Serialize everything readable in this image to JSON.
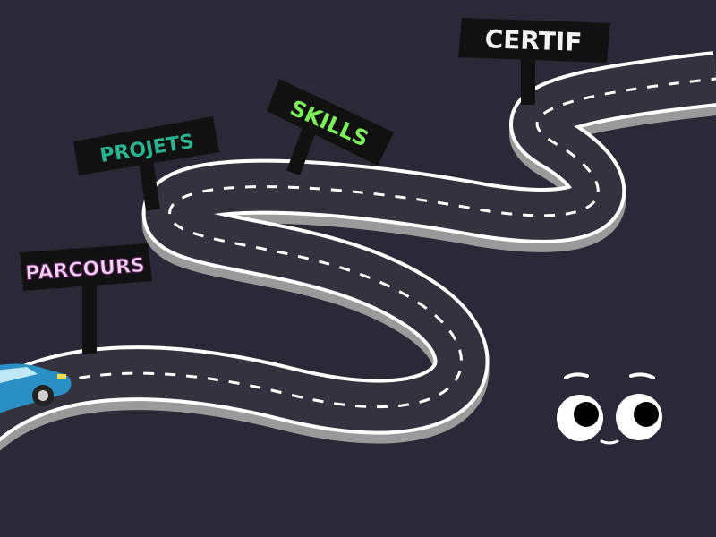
{
  "signs": {
    "parcours": {
      "label": "PARCOURS",
      "color": "#f2d7f2"
    },
    "projets": {
      "label": "PROJETS",
      "color": "#29b38f"
    },
    "skills": {
      "label": "SKILLS",
      "color": "#7cf05a"
    },
    "certif": {
      "label": "CERTIF",
      "color": "#f2f2f2"
    }
  },
  "colors": {
    "background": "#2b2838",
    "road": "#35323f",
    "road_edge": "#ffffff",
    "road_shadow": "#9a9a9a",
    "car": "#2a8fc4",
    "sign_board": "#111111"
  },
  "icons": {
    "car": "car-icon",
    "face": "eyes-face-icon"
  }
}
